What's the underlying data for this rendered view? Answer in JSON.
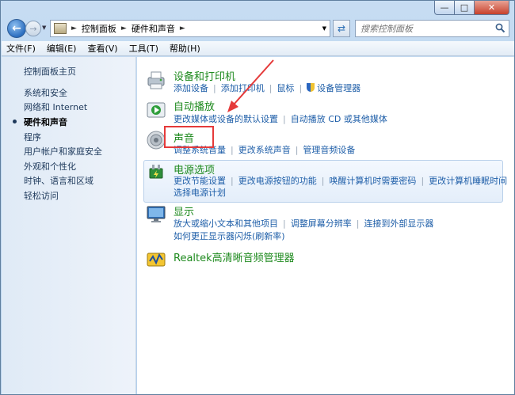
{
  "window": {
    "caption_buttons": {
      "minimize": "—",
      "maximize": "□",
      "close": "✕"
    }
  },
  "nav": {
    "breadcrumb": [
      "控制面板",
      "硬件和声音"
    ],
    "search_placeholder": "搜索控制面板"
  },
  "menu": [
    "文件(F)",
    "编辑(E)",
    "查看(V)",
    "工具(T)",
    "帮助(H)"
  ],
  "sidebar": {
    "items": [
      {
        "label": "控制面板主页",
        "current": false
      },
      {
        "label": "系统和安全",
        "current": false
      },
      {
        "label": "网络和 Internet",
        "current": false
      },
      {
        "label": "硬件和声音",
        "current": true
      },
      {
        "label": "程序",
        "current": false
      },
      {
        "label": "用户帐户和家庭安全",
        "current": false
      },
      {
        "label": "外观和个性化",
        "current": false
      },
      {
        "label": "时钟、语言和区域",
        "current": false
      },
      {
        "label": "轻松访问",
        "current": false
      }
    ]
  },
  "categories": [
    {
      "title": "设备和打印机",
      "icon": "printer-icon",
      "tasks": [
        "添加设备",
        "添加打印机",
        "鼠标",
        "设备管理器"
      ]
    },
    {
      "title": "自动播放",
      "icon": "autoplay-icon",
      "tasks": [
        "更改媒体或设备的默认设置",
        "自动播放 CD 或其他媒体"
      ]
    },
    {
      "title": "声音",
      "icon": "speaker-icon",
      "tasks": [
        "调整系统音量",
        "更改系统声音",
        "管理音频设备"
      ]
    },
    {
      "title": "电源选项",
      "icon": "power-icon",
      "tasks": [
        "更改节能设置",
        "更改电源按钮的功能",
        "唤醒计算机时需要密码",
        "更改计算机睡眠时间",
        "选择电源计划"
      ]
    },
    {
      "title": "显示",
      "icon": "display-icon",
      "tasks": [
        "放大或缩小文本和其他项目",
        "调整屏幕分辨率",
        "连接到外部显示器",
        "如何更正显示器闪烁(刷新率)"
      ]
    },
    {
      "title": "Realtek高清晰音频管理器",
      "icon": "realtek-icon",
      "tasks": []
    }
  ],
  "colors": {
    "link": "#1e5ea8",
    "category_title": "#1e8a1e",
    "annotation": "#e53a3a"
  }
}
